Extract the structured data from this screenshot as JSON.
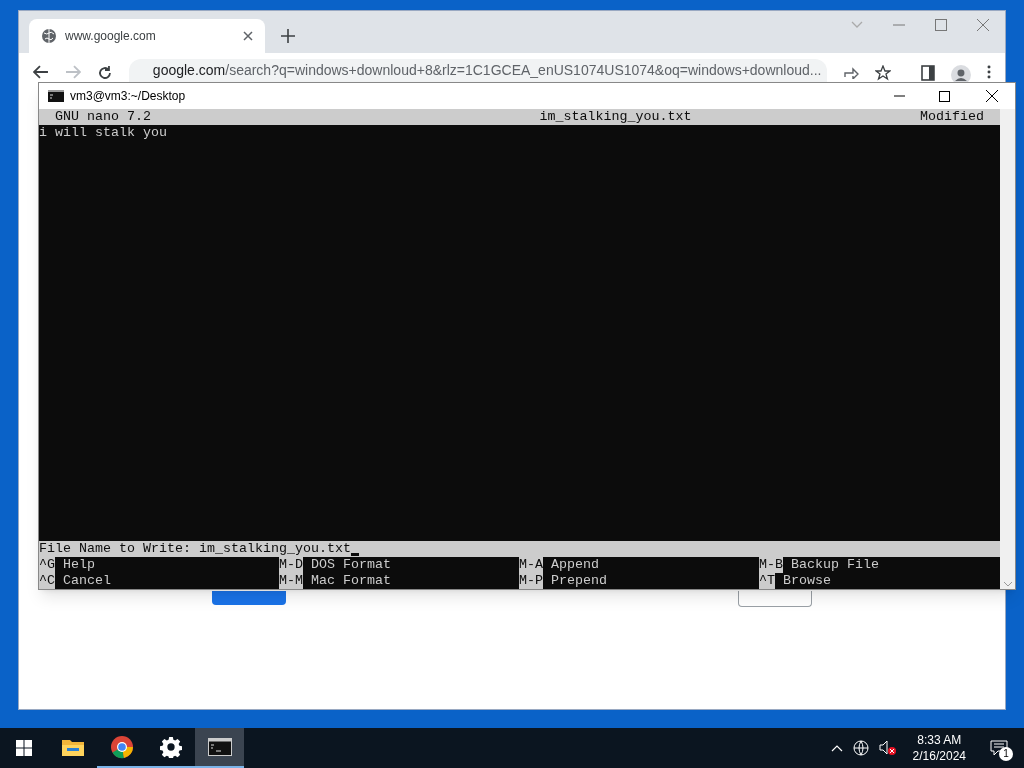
{
  "browser": {
    "tab": {
      "title": "www.google.com"
    },
    "address_host": "google.com",
    "address_path": "/search?q=windows+downloud+8&rlz=1C1GCEA_enUS1074US1074&oq=windows+downloud..."
  },
  "terminal": {
    "title": "vm3@vm3:~/Desktop",
    "header": {
      "version": "GNU nano 7.2",
      "filename": "im_stalking_you.txt",
      "status": "Modified"
    },
    "lines": [
      "i will stalk you"
    ],
    "prompt": {
      "label": "File Name to Write: ",
      "value": "im_stalking_you.txt"
    },
    "shortcuts": [
      [
        {
          "key": "^G",
          "label": "Help"
        },
        {
          "key": "M-D",
          "label": "DOS Format"
        },
        {
          "key": "M-A",
          "label": "Append"
        },
        {
          "key": "M-B",
          "label": "Backup File"
        }
      ],
      [
        {
          "key": "^C",
          "label": "Cancel"
        },
        {
          "key": "M-M",
          "label": "Mac Format"
        },
        {
          "key": "M-P",
          "label": "Prepend"
        },
        {
          "key": "^T",
          "label": "Browse"
        }
      ]
    ]
  },
  "taskbar": {
    "apps": [
      {
        "kind": "explorer",
        "running": false,
        "selected": false
      },
      {
        "kind": "chrome",
        "running": true,
        "selected": false
      },
      {
        "kind": "settings",
        "running": true,
        "selected": false
      },
      {
        "kind": "terminal",
        "running": true,
        "selected": true
      }
    ],
    "time": "8:33 AM",
    "date": "2/16/2024",
    "notifications": "1"
  }
}
